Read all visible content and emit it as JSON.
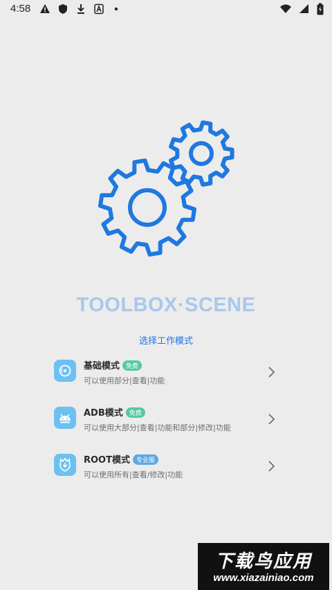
{
  "status_bar": {
    "time": "4:58",
    "left_icons": [
      "warning-icon",
      "shield-icon",
      "download-icon",
      "app-a-icon",
      "dot-icon"
    ],
    "right_icons": [
      "wifi-icon",
      "signal-icon",
      "battery-charging-icon"
    ]
  },
  "app": {
    "title": "TOOLBOX·SCENE",
    "prompt": "选择工作模式",
    "accent_color": "#1f78e0",
    "title_color": "#a8c7ee",
    "icon": "gears-icon"
  },
  "modes": [
    {
      "title": "基础模式",
      "badge": "免费",
      "badge_type": "free",
      "desc": "可以使用部分|查看|功能",
      "icon": "disc-icon"
    },
    {
      "title": "ADB模式",
      "badge": "免费",
      "badge_type": "free",
      "desc": "可以使用大部分|查看|功能和部分|修改|功能",
      "icon": "android-icon"
    },
    {
      "title": "ROOT模式",
      "badge": "专业版",
      "badge_type": "pro",
      "desc": "可以使用所有|查看/修改|功能",
      "icon": "root-icon"
    }
  ],
  "watermark": {
    "cn": "下载鸟应用",
    "url": "www.xiazainiao.com"
  }
}
